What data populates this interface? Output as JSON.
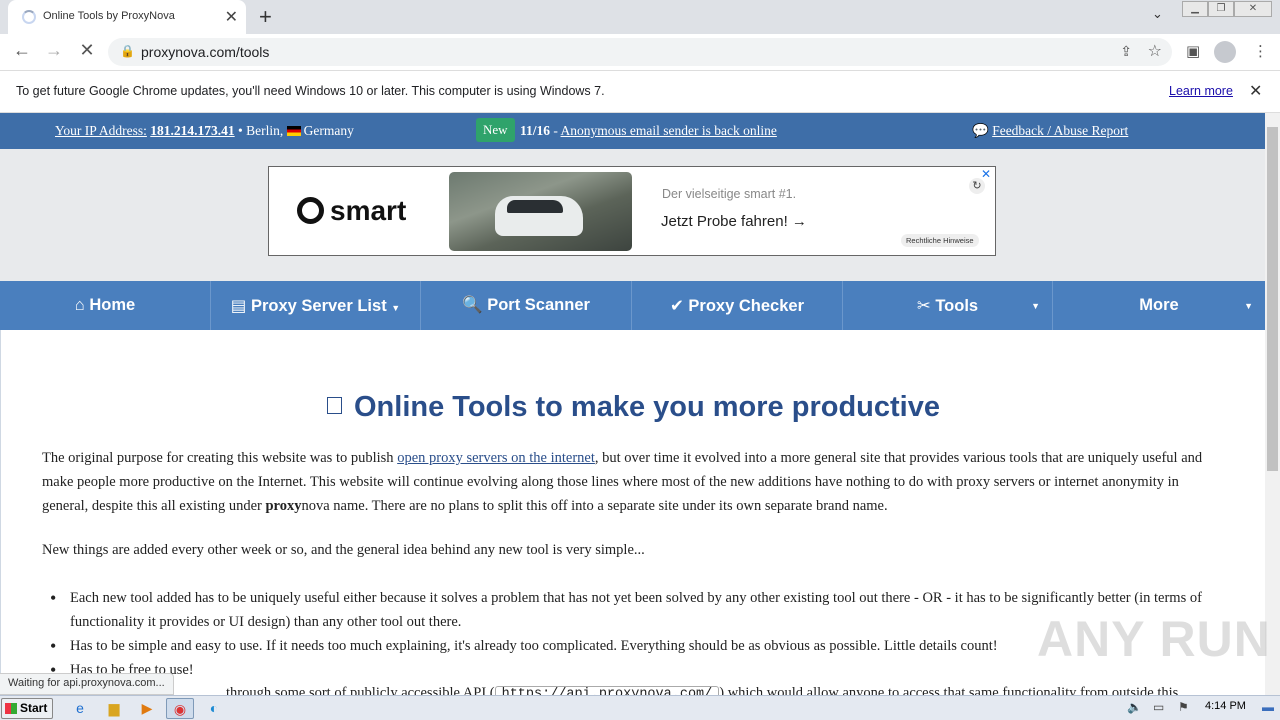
{
  "browser": {
    "tab_title": "Online Tools by ProxyNova",
    "url": "proxynova.com/tools",
    "infobar_message": "To get future Google Chrome updates, you'll need Windows 10 or later. This computer is using Windows 7.",
    "infobar_link": "Learn more"
  },
  "topbar": {
    "ip_label": "Your IP Address:",
    "ip_value": "181.214.173.41",
    "location_city": "• Berlin,",
    "location_country": "Germany",
    "new_badge": "New",
    "news_date": "11/16",
    "news_dash": "-",
    "news_text": "Anonymous email sender is back online",
    "feedback": "Feedback / Abuse Report"
  },
  "ad": {
    "brand": "smart",
    "tagline": "Der vielseitige smart #1.",
    "cta": "Jetzt Probe fahren! →",
    "legal": "Rechtliche Hinweise"
  },
  "nav": {
    "items": [
      {
        "label": "Home",
        "icon": "home-icon"
      },
      {
        "label": "Proxy Server List",
        "icon": "list-icon"
      },
      {
        "label": "Port Scanner",
        "icon": "search-icon"
      },
      {
        "label": "Proxy Checker",
        "icon": "check-icon"
      },
      {
        "label": "Tools",
        "icon": "tools-icon"
      },
      {
        "label": "More",
        "icon": ""
      }
    ]
  },
  "content": {
    "title": "Online Tools to make you more productive",
    "p1_a": "The original purpose for creating this website was to publish ",
    "p1_link": "open proxy servers on the internet",
    "p1_b": ", but over time it evolved into a more general site that provides various tools that are uniquely useful and make people more productive on the Internet. This website will continue evolving along those lines where most of the new additions have nothing to do with proxy servers or internet anonymity in general, despite this all existing under ",
    "p1_bold": "proxy",
    "p1_c": "nova name. There are no plans to split this off into a separate site under its own separate brand name.",
    "p2": "New things are added every other week or so, and the general idea behind any new tool is very simple...",
    "bullets": [
      "Each new tool added has to be uniquely useful either because it solves a problem that has not yet been solved by any other existing tool out there - OR - it has to be significantly better (in terms of functionality it provides or UI design) than any other tool out there.",
      "Has to be simple and easy to use. If it needs too much explaining, it's already too complicated. Everything should be as obvious as possible. Little details count!",
      "Has to be free to use!"
    ],
    "partial_a": "through some sort of publicly accessible API (",
    "partial_code": "https://api.proxynova.com/",
    "partial_b": ") which would allow anyone to access that same functionality from outside this"
  },
  "status_text": "Waiting for api.proxynova.com...",
  "watermark": "ANY RUN",
  "taskbar": {
    "start": "Start",
    "clock": "4:14 PM"
  }
}
